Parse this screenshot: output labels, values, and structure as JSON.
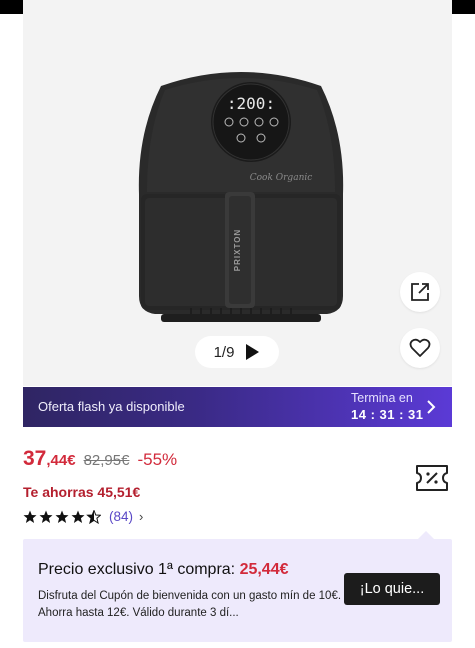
{
  "gallery": {
    "pager_text": "1/9",
    "product": {
      "display_text": "200",
      "brand": "PRIXTON",
      "script_text": "Cook Organic"
    }
  },
  "flash": {
    "label": "Oferta flash ya disponible",
    "ends_label": "Termina en",
    "timer": "14 : 31 : 31"
  },
  "price": {
    "current_main": "37",
    "current_cents": ",44€",
    "old": "82,95€",
    "discount": "-55%",
    "savings": "Te ahorras 45,51€"
  },
  "rating": {
    "stars": 4.5,
    "count": "(84)"
  },
  "promo": {
    "title_prefix": "Precio exclusivo 1ª compra: ",
    "title_price": "25,44€",
    "description": "Disfruta del Cupón de bienvenida con un gasto mín de 10€. Ahorra hasta 12€. Válido durante 3 dí...",
    "button_label": "¡Lo quie..."
  },
  "colors": {
    "accent_red": "#d22a3b",
    "flash_start": "#2f2563",
    "flash_end": "#5b3ad6",
    "promo_bg": "#eeeafc",
    "rating_link": "#5a48c6"
  }
}
